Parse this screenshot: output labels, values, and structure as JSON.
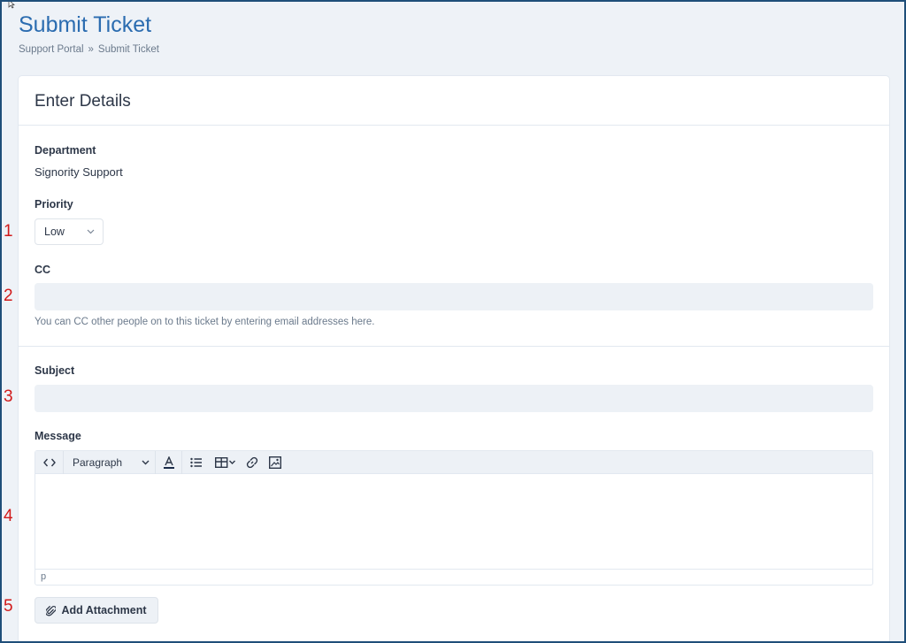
{
  "header": {
    "title": "Submit Ticket",
    "breadcrumb": [
      "Support Portal",
      "Submit Ticket"
    ],
    "breadcrumb_separator": "»"
  },
  "card": {
    "title": "Enter Details",
    "department": {
      "label": "Department",
      "value": "Signority Support"
    },
    "priority": {
      "label": "Priority",
      "selected": "Low"
    },
    "cc": {
      "label": "CC",
      "value": "",
      "help": "You can CC other people on to this ticket by entering email addresses here."
    },
    "subject": {
      "label": "Subject",
      "value": ""
    },
    "message": {
      "label": "Message",
      "toolbar": {
        "format_label": "Paragraph"
      },
      "status_path": "p"
    },
    "attach_label": "Add Attachment"
  },
  "annotations": [
    "1",
    "2",
    "3",
    "4",
    "5"
  ],
  "colors": {
    "accent": "#2b6cb0",
    "annotation": "#d11a1a",
    "input_bg": "#edf1f6"
  }
}
